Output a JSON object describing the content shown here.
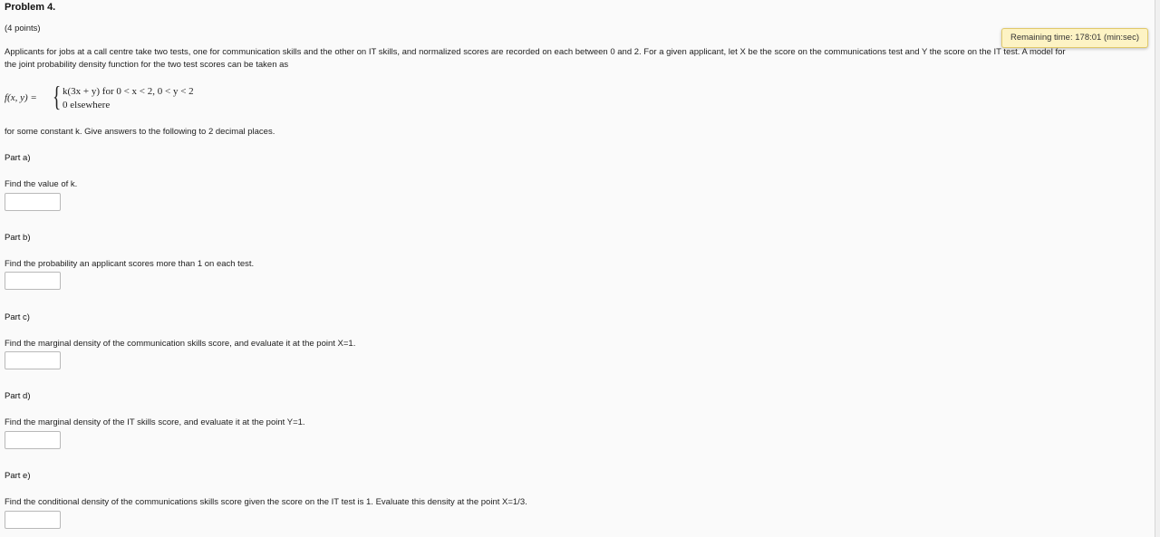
{
  "problem": {
    "title": "Problem 4.",
    "points": "(4 points)",
    "timer": "Remaining time: 178:01 (min:sec)",
    "intro_line1": "Applicants for jobs at a call centre take two tests, one for communication skills and the other on IT skills, and normalized scores are recorded on each between 0 and 2. For a given applicant, let X be the score on the communications test and Y the score on the IT test. A model for",
    "intro_line2": "the joint probability density function for the two test scores can be taken as",
    "formula_lhs": "f(x, y) =",
    "formula_case1": "k(3x + y) for 0 < x < 2, 0 < y < 2",
    "formula_case2": "0 elsewhere",
    "constant_text": "for some constant k. Give answers to the following to 2 decimal places."
  },
  "parts": [
    {
      "heading": "Part a)",
      "question": "Find the value of k.",
      "answer": ""
    },
    {
      "heading": "Part b)",
      "question": "Find the probability an applicant scores more than 1 on each test.",
      "answer": ""
    },
    {
      "heading": "Part c)",
      "question": "Find the marginal density of the communication skills score, and evaluate it at the point X=1.",
      "answer": ""
    },
    {
      "heading": "Part d)",
      "question": "Find the marginal density of the IT skills score, and evaluate it at the point Y=1.",
      "answer": ""
    },
    {
      "heading": "Part e)",
      "question": "Find the conditional density of the communications skills score given the score on the IT test is 1. Evaluate this density at the point X=1/3.",
      "answer": ""
    }
  ]
}
